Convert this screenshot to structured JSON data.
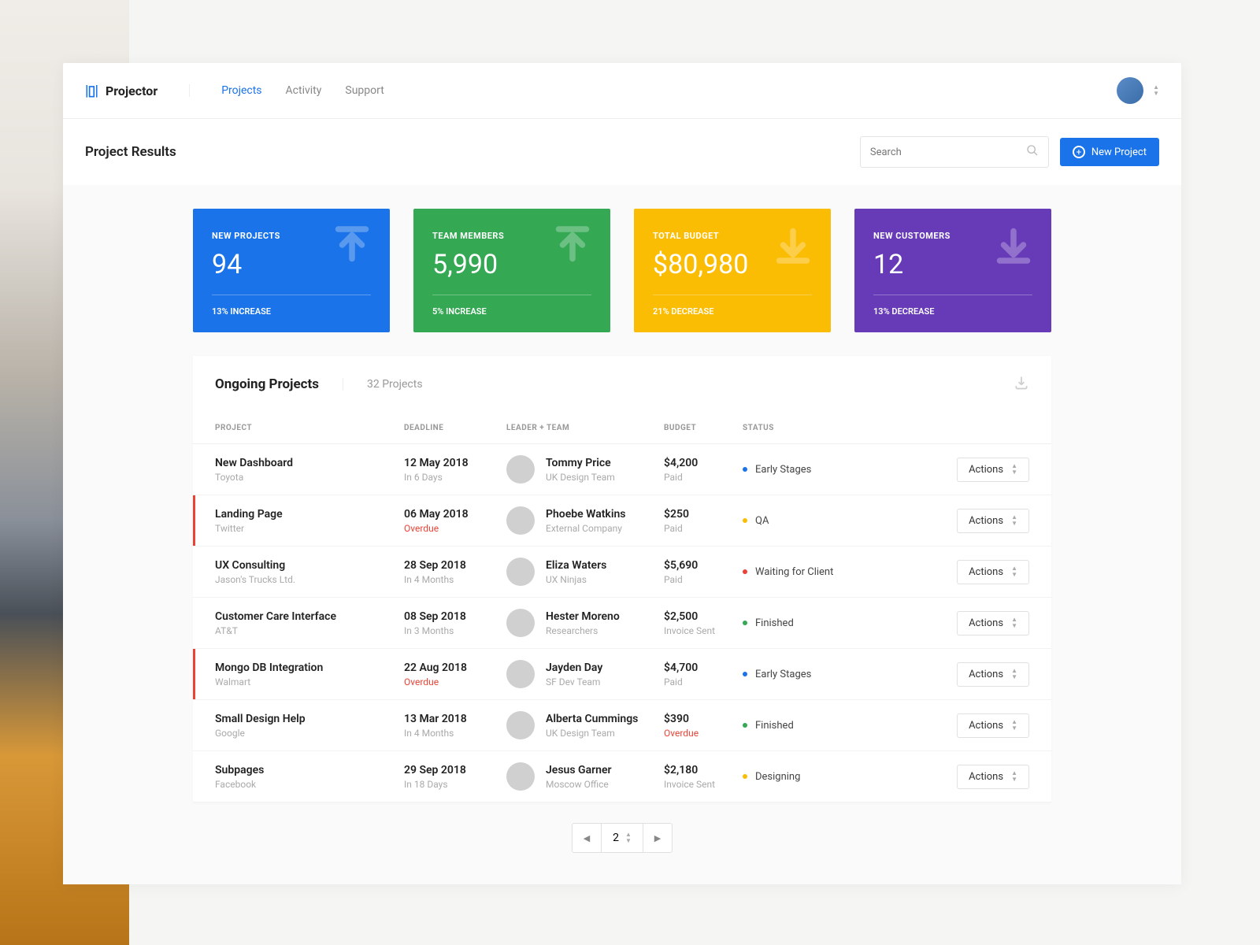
{
  "brand": "Projector",
  "nav": {
    "projects": "Projects",
    "activity": "Activity",
    "support": "Support"
  },
  "subbar": {
    "title": "Project Results",
    "search_placeholder": "Search",
    "new_project": "New Project"
  },
  "cards": [
    {
      "label": "NEW PROJECTS",
      "value": "94",
      "delta": "13% INCREASE",
      "dir": "up",
      "color": "blue"
    },
    {
      "label": "TEAM MEMBERS",
      "value": "5,990",
      "delta": "5% INCREASE",
      "dir": "up",
      "color": "green"
    },
    {
      "label": "TOTAL BUDGET",
      "value": "$80,980",
      "delta": "21% DECREASE",
      "dir": "down",
      "color": "orange"
    },
    {
      "label": "NEW CUSTOMERS",
      "value": "12",
      "delta": "13% DECREASE",
      "dir": "down",
      "color": "purple"
    }
  ],
  "panel": {
    "title": "Ongoing Projects",
    "count": "32 Projects"
  },
  "cols": {
    "project": "PROJECT",
    "deadline": "DEADLINE",
    "leader": "LEADER + TEAM",
    "budget": "BUDGET",
    "status": "STATUS"
  },
  "status_colors": {
    "Early Stages": "#1a73e8",
    "QA": "#fbbc04",
    "Waiting for Client": "#ea4335",
    "Finished": "#34a853",
    "Designing": "#fbbc04"
  },
  "rows": [
    {
      "title": "New Dashboard",
      "client": "Toyota",
      "deadline": "12 May 2018",
      "due": "In 6 Days",
      "overdue": false,
      "leader": "Tommy Price",
      "team": "UK Design Team",
      "budget": "$4,200",
      "budget_status": "Paid",
      "budget_red": false,
      "status": "Early Stages"
    },
    {
      "title": "Landing Page",
      "client": "Twitter",
      "deadline": "06 May 2018",
      "due": "Overdue",
      "overdue": true,
      "leader": "Phoebe Watkins",
      "team": "External Company",
      "budget": "$250",
      "budget_status": "Paid",
      "budget_red": false,
      "status": "QA"
    },
    {
      "title": "UX Consulting",
      "client": "Jason's Trucks Ltd.",
      "deadline": "28 Sep 2018",
      "due": "In 4 Months",
      "overdue": false,
      "leader": "Eliza Waters",
      "team": "UX Ninjas",
      "budget": "$5,690",
      "budget_status": "Paid",
      "budget_red": false,
      "status": "Waiting for Client"
    },
    {
      "title": "Customer Care Interface",
      "client": "AT&T",
      "deadline": "08 Sep 2018",
      "due": "In 3 Months",
      "overdue": false,
      "leader": "Hester Moreno",
      "team": "Researchers",
      "budget": "$2,500",
      "budget_status": "Invoice Sent",
      "budget_red": false,
      "status": "Finished"
    },
    {
      "title": "Mongo DB Integration",
      "client": "Walmart",
      "deadline": "22 Aug 2018",
      "due": "Overdue",
      "overdue": true,
      "leader": "Jayden Day",
      "team": "SF Dev Team",
      "budget": "$4,700",
      "budget_status": "Paid",
      "budget_red": false,
      "status": "Early Stages"
    },
    {
      "title": "Small Design Help",
      "client": "Google",
      "deadline": "13 Mar 2018",
      "due": "In 4 Months",
      "overdue": false,
      "leader": "Alberta Cummings",
      "team": "UK Design Team",
      "budget": "$390",
      "budget_status": "Overdue",
      "budget_red": true,
      "status": "Finished"
    },
    {
      "title": "Subpages",
      "client": "Facebook",
      "deadline": "29 Sep 2018",
      "due": "In 18 Days",
      "overdue": false,
      "leader": "Jesus Garner",
      "team": "Moscow Office",
      "budget": "$2,180",
      "budget_status": "Invoice Sent",
      "budget_red": false,
      "status": "Designing"
    }
  ],
  "actions_label": "Actions",
  "page": "2"
}
